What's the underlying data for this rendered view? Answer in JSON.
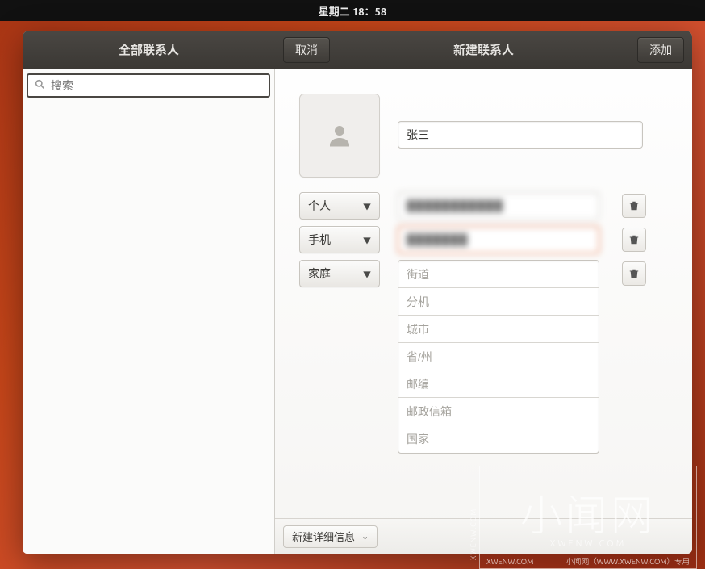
{
  "topbar": {
    "clock": "星期二 18：58"
  },
  "titlebar": {
    "left_title": "全部联系人",
    "cancel": "取消",
    "center_title": "新建联系人",
    "add": "添加"
  },
  "search": {
    "placeholder": "搜索"
  },
  "form": {
    "name_value": "张三",
    "email_type": "个人",
    "email_value": "███████████",
    "phone_type": "手机",
    "phone_value": "███████",
    "address_type": "家庭",
    "address": {
      "street": "街道",
      "ext": "分机",
      "city": "城市",
      "state": "省/州",
      "zip": "邮编",
      "pobox": "邮政信箱",
      "country": "国家"
    }
  },
  "footer": {
    "new_detail": "新建详细信息"
  },
  "watermark": {
    "big": "小闻网",
    "sub": "XWENW.COM",
    "left": "XWENW.COM",
    "bar_right": "小闻网（WWW.XWENW.COM）专用"
  }
}
